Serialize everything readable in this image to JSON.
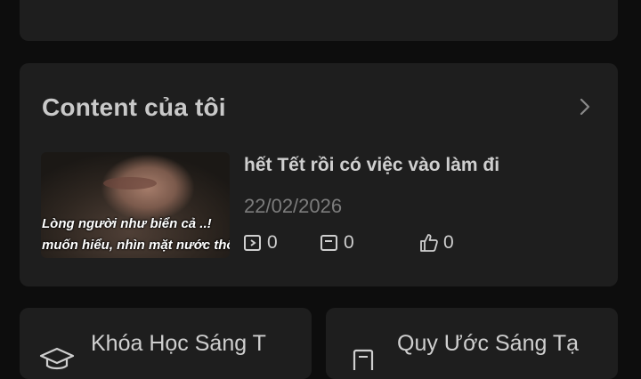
{
  "content_section": {
    "title": "Content của tôi",
    "post": {
      "title": "hết Tết rồi có việc vào làm đi",
      "date": "22/02/2026",
      "thumbnail_caption_line1": "Lòng người như biển cả ..!",
      "thumbnail_caption_line2": "muốn hiểu, nhìn mặt nước thôi là chưa đủ ..",
      "stats": {
        "views": "0",
        "comments": "0",
        "likes": "0"
      }
    }
  },
  "shortcuts": [
    {
      "label": "Khóa Học Sáng T",
      "icon": "graduation-cap-icon"
    },
    {
      "label": "Quy Ước Sáng Tạ",
      "icon": "document-icon"
    }
  ]
}
